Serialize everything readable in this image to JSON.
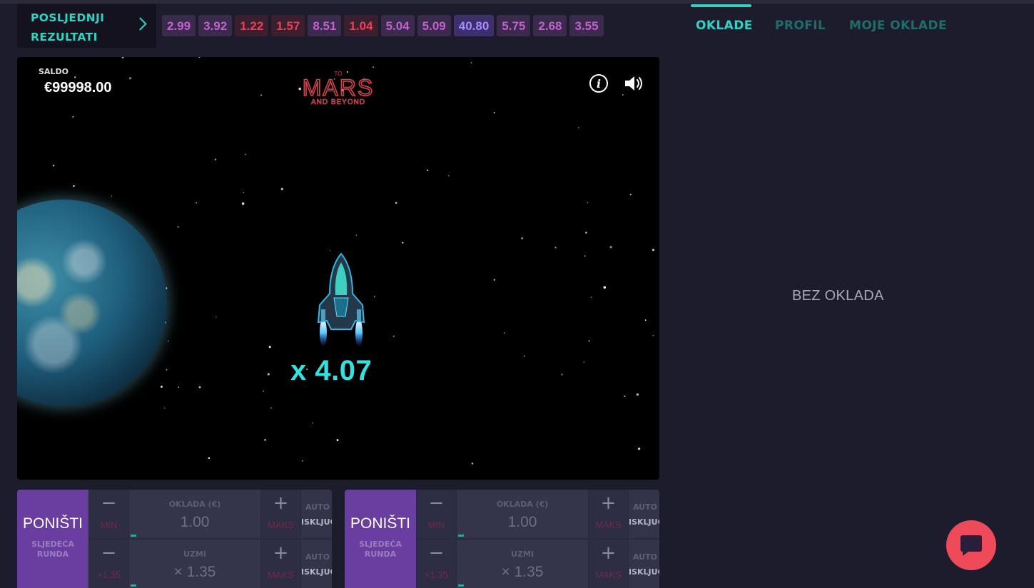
{
  "header": {
    "last_results_label": "POSLJEDNJI REZULTATI",
    "results": [
      {
        "value": "2.99",
        "tone": "pur"
      },
      {
        "value": "3.92",
        "tone": "pur"
      },
      {
        "value": "1.22",
        "tone": "red"
      },
      {
        "value": "1.57",
        "tone": "red"
      },
      {
        "value": "8.51",
        "tone": "pur"
      },
      {
        "value": "1.04",
        "tone": "red"
      },
      {
        "value": "5.04",
        "tone": "pur"
      },
      {
        "value": "5.09",
        "tone": "pur"
      },
      {
        "value": "40.80",
        "tone": "blue"
      },
      {
        "value": "5.75",
        "tone": "pur"
      },
      {
        "value": "2.68",
        "tone": "pur"
      },
      {
        "value": "3.55",
        "tone": "pur"
      }
    ]
  },
  "game": {
    "saldo_label": "SALDO",
    "saldo_value": "€99998.00",
    "logo_top": "TO",
    "logo_main": "MARS",
    "logo_sub": "AND BEYOND",
    "multiplier": "x 4.07",
    "icons": [
      "info-icon",
      "speaker-icon",
      "rocket-icon",
      "planet-earth"
    ]
  },
  "tabs": [
    {
      "label": "OKLADE",
      "active": true
    },
    {
      "label": "PROFIL",
      "active": false
    },
    {
      "label": "MOJE OKLADE",
      "active": false
    }
  ],
  "bets_panel": {
    "empty_text": "BEZ OKLADA"
  },
  "bet_panels": [
    {
      "cancel_label": "PONIŠTI",
      "cancel_sub": "SLJEDEĆA RUNDA",
      "bet_label": "OKLADA (€)",
      "bet_value": "1.00",
      "cashout_label": "UZMI",
      "cashout_value": "× 1.35",
      "minus_symbol": "−",
      "plus_symbol": "+",
      "min_label": "MIN",
      "max_label": "MAKS",
      "min_cashout_label": "×1.35",
      "auto_label": "AUTO",
      "auto_state": "ISKLJUČENO"
    },
    {
      "cancel_label": "PONIŠTI",
      "cancel_sub": "SLJEDEĆA RUNDA",
      "bet_label": "OKLADA (€)",
      "bet_value": "1.00",
      "cashout_label": "UZMI",
      "cashout_value": "× 1.35",
      "minus_symbol": "−",
      "plus_symbol": "+",
      "min_label": "MIN",
      "max_label": "MAKS",
      "min_cashout_label": "×1.35",
      "auto_label": "AUTO",
      "auto_state": "ISKLJUČENO"
    }
  ],
  "chat": {
    "icon": "chat-bubble-icon"
  },
  "colors": {
    "accent": "#2fd3c4",
    "cancel_button": "#6a3da0",
    "chat_button": "#ef4a5a",
    "multiplier": "#30e3e0"
  }
}
